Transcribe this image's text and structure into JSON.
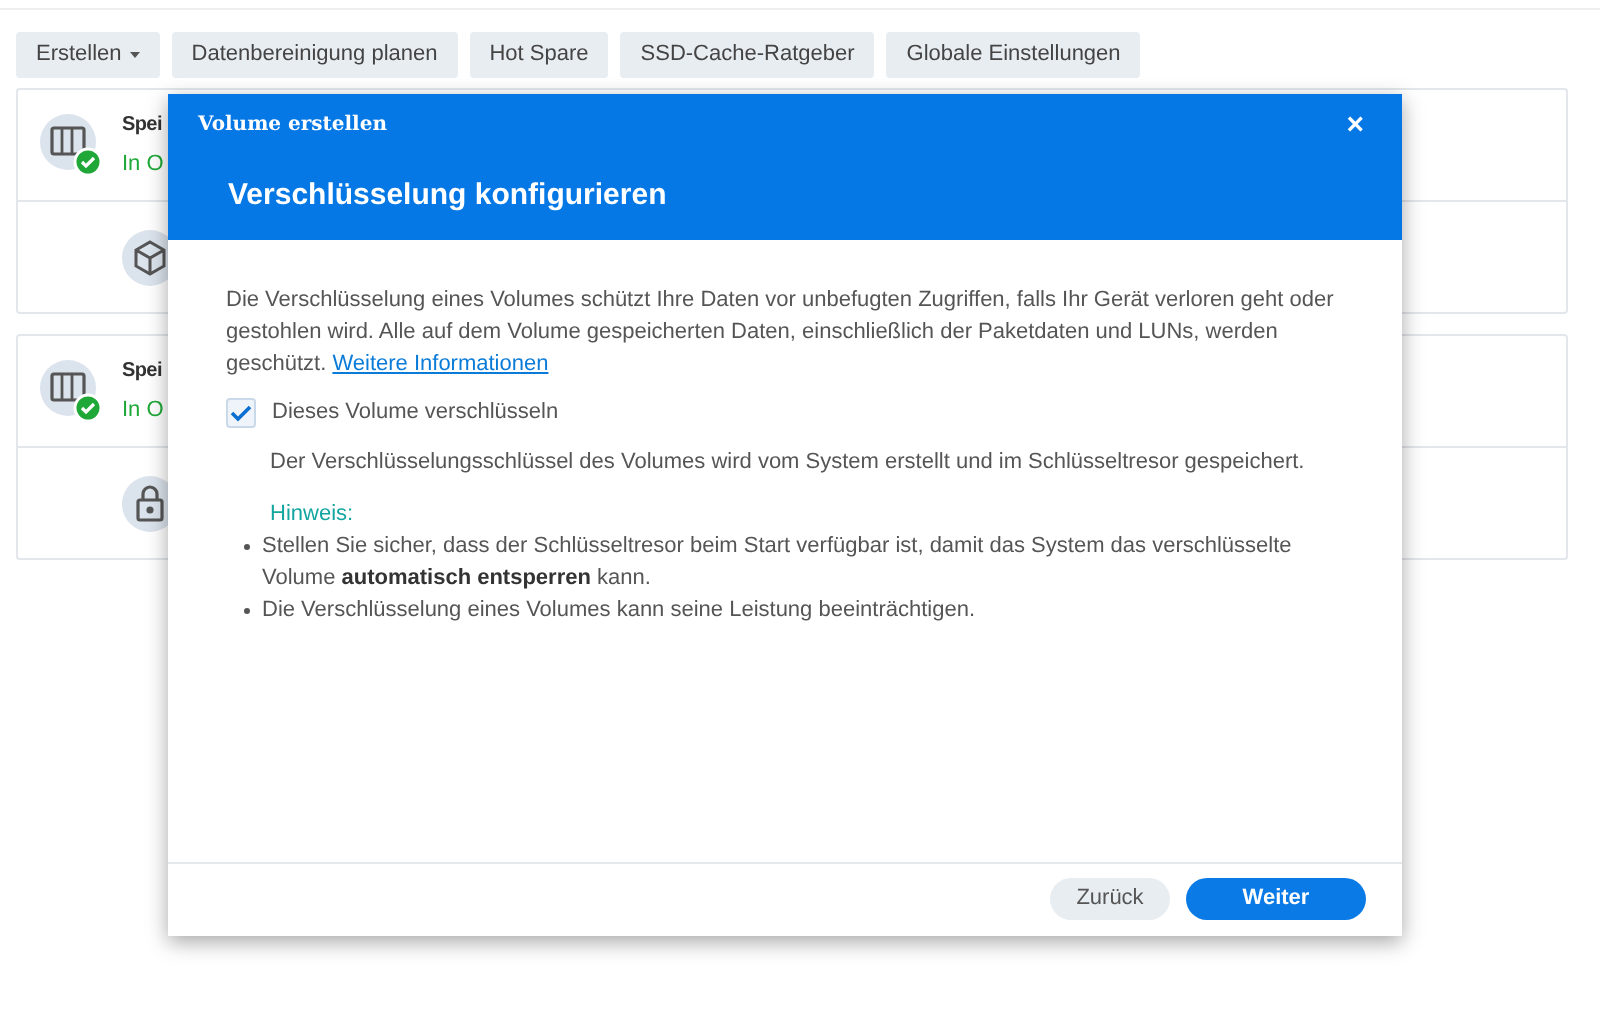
{
  "toolbar": [
    {
      "label": "Erstellen",
      "dropdown": true
    },
    {
      "label": "Datenbereinigung planen",
      "dropdown": false
    },
    {
      "label": "Hot Spare",
      "dropdown": false
    },
    {
      "label": "SSD-Cache-Ratgeber",
      "dropdown": false
    },
    {
      "label": "Globale Einstellungen",
      "dropdown": false
    }
  ],
  "pools": [
    {
      "title": "Spei",
      "status": "In O",
      "kind": "cube"
    },
    {
      "title": "Spei",
      "status": "In O",
      "kind": "lock"
    }
  ],
  "dialog": {
    "window_title": "Volume erstellen",
    "close": "×",
    "heading": "Verschlüsselung konfigurieren",
    "intro": "Die Verschlüsselung eines Volumes schützt Ihre Daten vor unbefugten Zugriffen, falls Ihr Gerät verloren geht oder gestohlen wird. Alle auf dem Volume gespeicherten Daten, einschließlich der Paketdaten und LUNs, werden geschützt.",
    "link": "Weitere Informationen",
    "checkbox": {
      "label": "Dieses Volume verschlüsseln",
      "checked": true
    },
    "key_note": "Der Verschlüsselungsschlüssel des Volumes wird vom System erstellt und im Schlüsseltresor gespeichert.",
    "hint_label": "Hinweis:",
    "hints": [
      "Stellen Sie sicher, dass der Schlüsseltresor beim Start verfügbar ist, damit das System das verschlüsselte Volume **automatisch entsperren** kann.",
      "Die Verschlüsselung eines Volumes kann seine Leistung beeinträchtigen."
    ],
    "buttons": [
      {
        "label": "Zurück",
        "kind": "secondary"
      },
      {
        "label": "Weiter",
        "kind": "primary"
      }
    ]
  }
}
